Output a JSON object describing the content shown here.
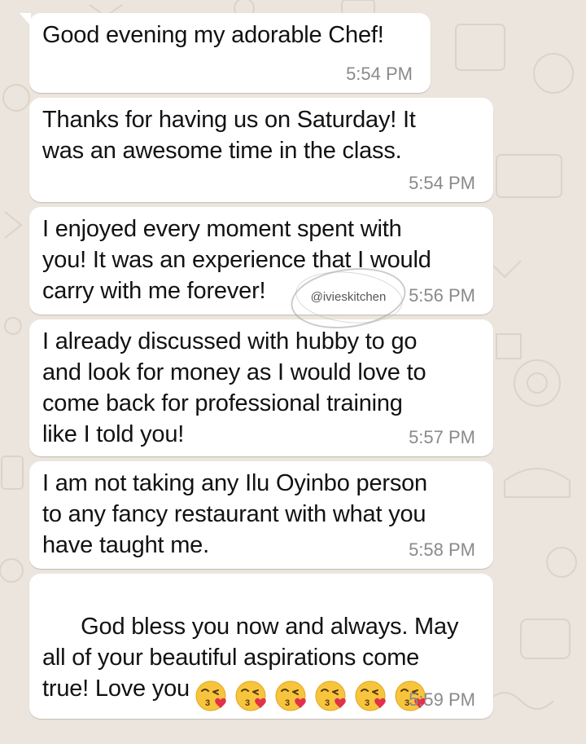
{
  "chat": {
    "messages": [
      {
        "text": "Good evening my adorable Chef!",
        "time": "5:54 PM"
      },
      {
        "text": "Thanks for having us on Saturday! It\nwas an awesome time in the class.",
        "time": "5:54 PM"
      },
      {
        "text": "I enjoyed every moment spent with\nyou! It was an experience that I would\ncarry with me forever!",
        "time": "5:56 PM"
      },
      {
        "text": "I already discussed with hubby to go\nand look for money as I would love to\ncome back for professional training\nlike I told you!",
        "time": "5:57 PM"
      },
      {
        "text": "I am not taking any Ilu Oyinbo person\nto any fancy restaurant with what you\nhave taught me.",
        "time": "5:58 PM"
      },
      {
        "text": "God bless you now and always. May\nall of your beautiful aspirations come\ntrue! Love you",
        "time": "5:59 PM",
        "emoji": "face-throwing-a-kiss-emoji",
        "emoji_count": 6
      }
    ]
  },
  "watermark": {
    "text": "@ivieskitchen"
  },
  "colors": {
    "wallpaper": "#ece5dd",
    "bubble": "#ffffff",
    "message_text": "#121212",
    "timestamp": "#8a8a8a"
  }
}
